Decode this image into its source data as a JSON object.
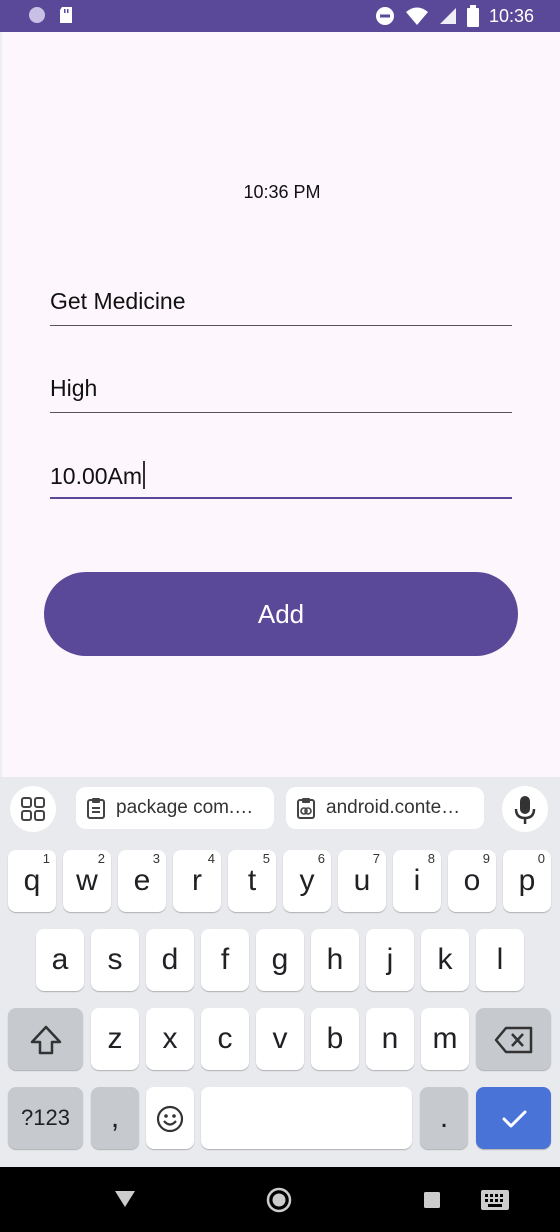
{
  "status_bar": {
    "time": "10:36"
  },
  "app": {
    "clock_text": "10:36 PM",
    "fields": [
      {
        "value": "Get Medicine"
      },
      {
        "value": "High"
      },
      {
        "value": "10.00Am"
      }
    ],
    "add_label": "Add"
  },
  "keyboard": {
    "suggestions": [
      {
        "label": "package com.…"
      },
      {
        "label": "android.conte…"
      }
    ],
    "row1": [
      {
        "key": "q",
        "hint": "1"
      },
      {
        "key": "w",
        "hint": "2"
      },
      {
        "key": "e",
        "hint": "3"
      },
      {
        "key": "r",
        "hint": "4"
      },
      {
        "key": "t",
        "hint": "5"
      },
      {
        "key": "y",
        "hint": "6"
      },
      {
        "key": "u",
        "hint": "7"
      },
      {
        "key": "i",
        "hint": "8"
      },
      {
        "key": "o",
        "hint": "9"
      },
      {
        "key": "p",
        "hint": "0"
      }
    ],
    "row2": [
      "a",
      "s",
      "d",
      "f",
      "g",
      "h",
      "j",
      "k",
      "l"
    ],
    "row3": [
      "z",
      "x",
      "c",
      "v",
      "b",
      "n",
      "m"
    ],
    "symbols_label": "?123",
    "comma": ",",
    "period": "."
  },
  "colors": {
    "accent": "#5a4898",
    "enter": "#4a73d8"
  }
}
